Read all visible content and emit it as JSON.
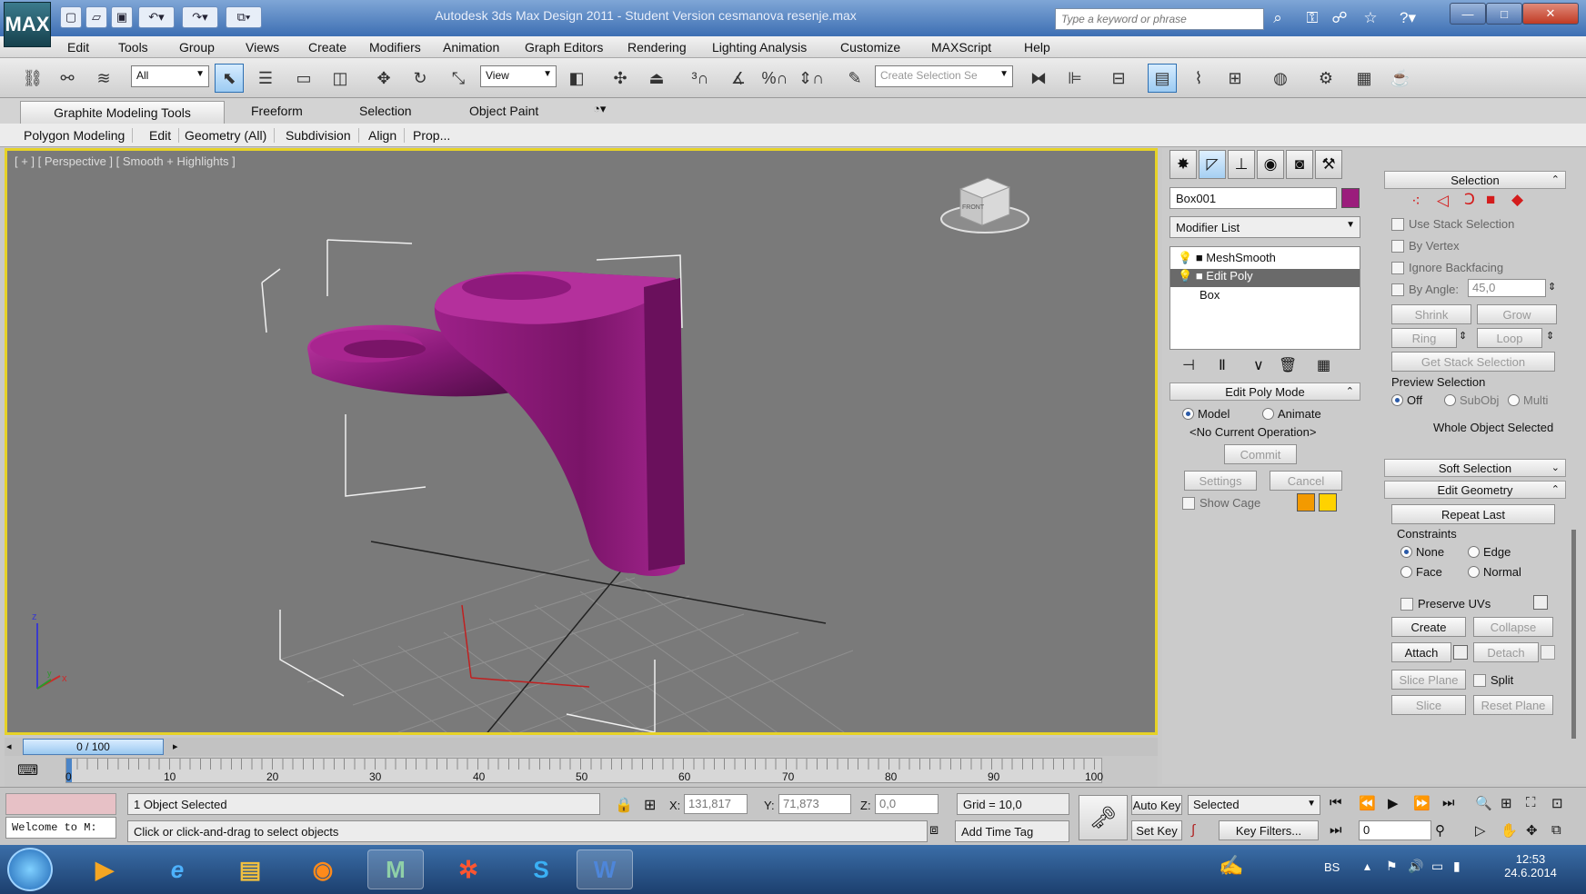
{
  "titlebar": {
    "app_logo": "MAX",
    "title": "Autodesk 3ds Max Design 2011 - Student Version   cesmanova resenje.max",
    "search_placeholder": "Type a keyword or phrase",
    "minimize": "—",
    "maximize": "□",
    "close": "✕"
  },
  "menubar": {
    "items": [
      "Edit",
      "Tools",
      "Group",
      "Views",
      "Create",
      "Modifiers",
      "Animation",
      "Graph Editors",
      "Rendering",
      "Lighting Analysis",
      "Customize",
      "MAXScript",
      "Help"
    ]
  },
  "toolbar": {
    "selection_filter": "All",
    "reference_coord": "View",
    "named_selection_placeholder": "Create Selection Se"
  },
  "ribbon": {
    "tabs": [
      "Graphite Modeling Tools",
      "Freeform",
      "Selection",
      "Object Paint"
    ],
    "subtabs": [
      "Polygon Modeling",
      "Edit",
      "Geometry (All)",
      "Subdivision",
      "Align",
      "Prop..."
    ]
  },
  "viewport": {
    "label": "[ + ] [ Perspective ] [ Smooth + Highlights ]",
    "object_color": "#8b1a7a",
    "viewcube_label": "FRONT",
    "axis_z": "z",
    "axis_x": "x",
    "axis_y": "y"
  },
  "command_panel": {
    "object_name": "Box001",
    "object_color": "#9b1d7c",
    "modifier_list_label": "Modifier List",
    "stack": [
      "MeshSmooth",
      "Edit Poly",
      "Box"
    ],
    "edit_poly_mode": {
      "title": "Edit Poly Mode",
      "model_label": "Model",
      "animate_label": "Animate",
      "current_op": "<No Current Operation>",
      "commit": "Commit",
      "settings": "Settings",
      "cancel": "Cancel",
      "show_cage": "Show Cage",
      "cage_color_1": "#f39a00",
      "cage_color_2": "#ffd200"
    },
    "selection": {
      "title": "Selection",
      "use_stack": "Use Stack Selection",
      "by_vertex": "By Vertex",
      "ignore_backfacing": "Ignore Backfacing",
      "by_angle": "By Angle:",
      "angle_value": "45,0",
      "shrink": "Shrink",
      "grow": "Grow",
      "ring": "Ring",
      "loop": "Loop",
      "get_stack": "Get Stack Selection",
      "preview_label": "Preview Selection",
      "off": "Off",
      "subobj": "SubObj",
      "multi": "Multi",
      "status": "Whole Object Selected"
    },
    "soft_selection": {
      "title": "Soft Selection"
    },
    "edit_geometry": {
      "title": "Edit Geometry",
      "repeat_last": "Repeat Last",
      "constraints": "Constraints",
      "none": "None",
      "edge": "Edge",
      "face": "Face",
      "normal": "Normal",
      "preserve_uvs": "Preserve UVs",
      "create": "Create",
      "collapse": "Collapse",
      "attach": "Attach",
      "detach": "Detach",
      "slice_plane": "Slice Plane",
      "split": "Split",
      "slice": "Slice",
      "reset_plane": "Reset Plane"
    }
  },
  "timeline": {
    "frame_indicator": "0 / 100",
    "progress_fraction": 0.0,
    "ticks": [
      "0",
      "10",
      "20",
      "30",
      "40",
      "50",
      "60",
      "70",
      "80",
      "90",
      "100"
    ]
  },
  "status": {
    "maxscript_listener": "Welcome to M:",
    "selected_count": "1 Object Selected",
    "prompt": "Click or click-and-drag to select objects",
    "x_label": "X:",
    "x_value": "131,817",
    "y_label": "Y:",
    "y_value": "71,873",
    "z_label": "Z:",
    "z_value": "0,0",
    "grid": "Grid = 10,0",
    "add_time_tag": "Add Time Tag",
    "auto_key": "Auto Key",
    "set_key": "Set Key",
    "key_mode": "Selected",
    "key_filters": "Key Filters...",
    "current_frame": "0"
  },
  "taskbar": {
    "language": "BS",
    "time": "12:53",
    "date": "24.6.2014"
  }
}
